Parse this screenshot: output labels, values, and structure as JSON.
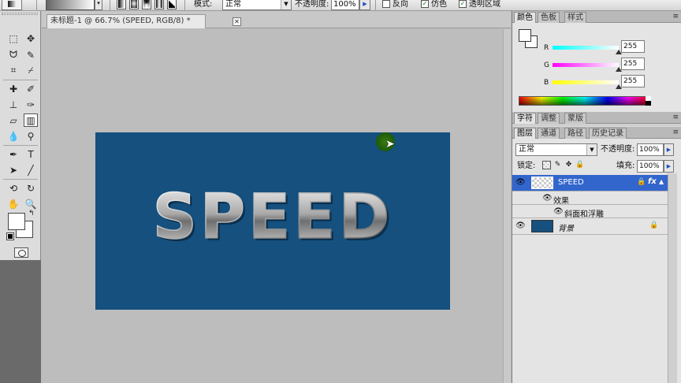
{
  "options_bar": {
    "mode_label": "模式:",
    "mode_value": "正常",
    "opacity_label": "不透明度:",
    "opacity_value": "100%",
    "reverse_label": "反向",
    "dither_label": "仿色",
    "transparency_label": "透明区域"
  },
  "document": {
    "tab_title": "未标题-1 @ 66.7% (SPEED, RGB/8) *",
    "close_glyph": "✕",
    "canvas_text": "SPEED",
    "canvas_color": "#15507e"
  },
  "color_panel": {
    "tabs": [
      "颜色",
      "色板",
      "样式"
    ],
    "channels": [
      {
        "label": "R",
        "value": "255"
      },
      {
        "label": "G",
        "value": "255"
      },
      {
        "label": "B",
        "value": "255"
      }
    ]
  },
  "character_panel": {
    "tabs": [
      "字符",
      "调整",
      "蒙版"
    ]
  },
  "layers_panel": {
    "tabs": [
      "图层",
      "通道",
      "路径",
      "历史记录"
    ],
    "blend_mode": "正常",
    "opacity_label": "不透明度:",
    "opacity_value": "100%",
    "lock_label": "锁定:",
    "fill_label": "填充:",
    "fill_value": "100%",
    "layers": [
      {
        "name": "SPEED"
      },
      {
        "name": "效果"
      },
      {
        "name": "斜面和浮雕"
      },
      {
        "name": "背景"
      }
    ]
  },
  "colors": {
    "selection": "#3366cc",
    "canvas_bg": "#15507e"
  }
}
